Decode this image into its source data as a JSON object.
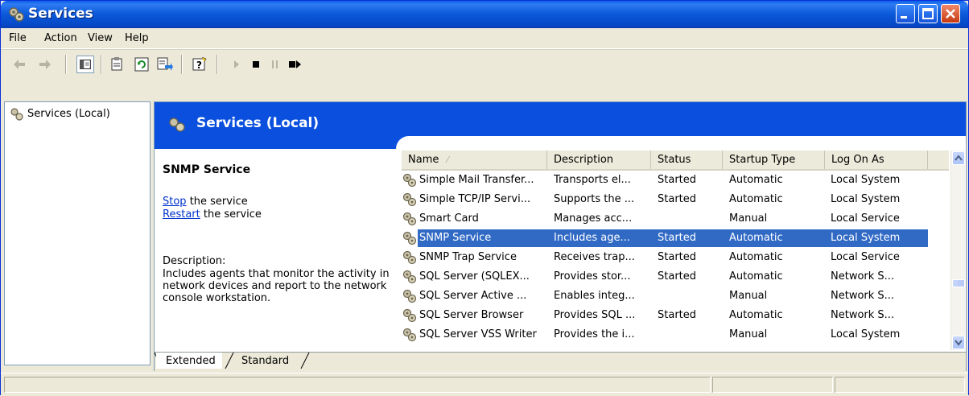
{
  "window": {
    "title": "Services",
    "controls": [
      "minimize-icon",
      "maximize-icon",
      "close-icon"
    ],
    "title_bar_color": "#0a58d8"
  },
  "menu": [
    "File",
    "Action",
    "View",
    "Help"
  ],
  "toolbar": {
    "icons": [
      "back-arrow-icon",
      "forward-arrow-icon",
      "show-hide-tree-icon",
      "properties-icon",
      "refresh-icon",
      "export-list-icon",
      "help-icon",
      "start-service-icon",
      "stop-service-icon",
      "pause-service-icon",
      "restart-service-icon"
    ]
  },
  "tree": {
    "items": [
      {
        "label": "Services (Local)",
        "icon": "services-gear-icon"
      }
    ]
  },
  "detail": {
    "header_title": "Services (Local)",
    "header_color": "#0a4fde",
    "extended": {
      "service_name": "SNMP Service",
      "stop_link": "Stop",
      "stop_suffix": " the service",
      "restart_link": "Restart",
      "restart_suffix": " the service",
      "description_label": "Description:",
      "description_text": "Includes agents that monitor the activity in network devices and report to the network console workstation."
    },
    "columns": [
      "Name",
      "Description",
      "Status",
      "Startup Type",
      "Log On As"
    ],
    "rows": [
      {
        "name": "Simple Mail Transfer...",
        "description": "Transports el...",
        "status": "Started",
        "startup": "Automatic",
        "logon": "Local System",
        "selected": false
      },
      {
        "name": "Simple TCP/IP Servi...",
        "description": "Supports the ...",
        "status": "Started",
        "startup": "Automatic",
        "logon": "Local System",
        "selected": false
      },
      {
        "name": "Smart Card",
        "description": "Manages acc...",
        "status": "",
        "startup": "Manual",
        "logon": "Local Service",
        "selected": false
      },
      {
        "name": "SNMP Service",
        "description": "Includes age...",
        "status": "Started",
        "startup": "Automatic",
        "logon": "Local System",
        "selected": true
      },
      {
        "name": "SNMP Trap Service",
        "description": "Receives trap...",
        "status": "Started",
        "startup": "Automatic",
        "logon": "Local Service",
        "selected": false
      },
      {
        "name": "SQL Server (SQLEX...",
        "description": "Provides stor...",
        "status": "Started",
        "startup": "Automatic",
        "logon": "Network S...",
        "selected": false
      },
      {
        "name": "SQL Server Active ...",
        "description": "Enables integ...",
        "status": "",
        "startup": "Manual",
        "logon": "Network S...",
        "selected": false
      },
      {
        "name": "SQL Server Browser",
        "description": "Provides SQL ...",
        "status": "Started",
        "startup": "Automatic",
        "logon": "Network S...",
        "selected": false
      },
      {
        "name": "SQL Server VSS Writer",
        "description": "Provides the i...",
        "status": "",
        "startup": "Manual",
        "logon": "Local System",
        "selected": false
      }
    ],
    "selection_color": "#316ac5",
    "tabs": [
      {
        "label": "Extended",
        "active": true
      },
      {
        "label": "Standard",
        "active": false
      }
    ]
  }
}
